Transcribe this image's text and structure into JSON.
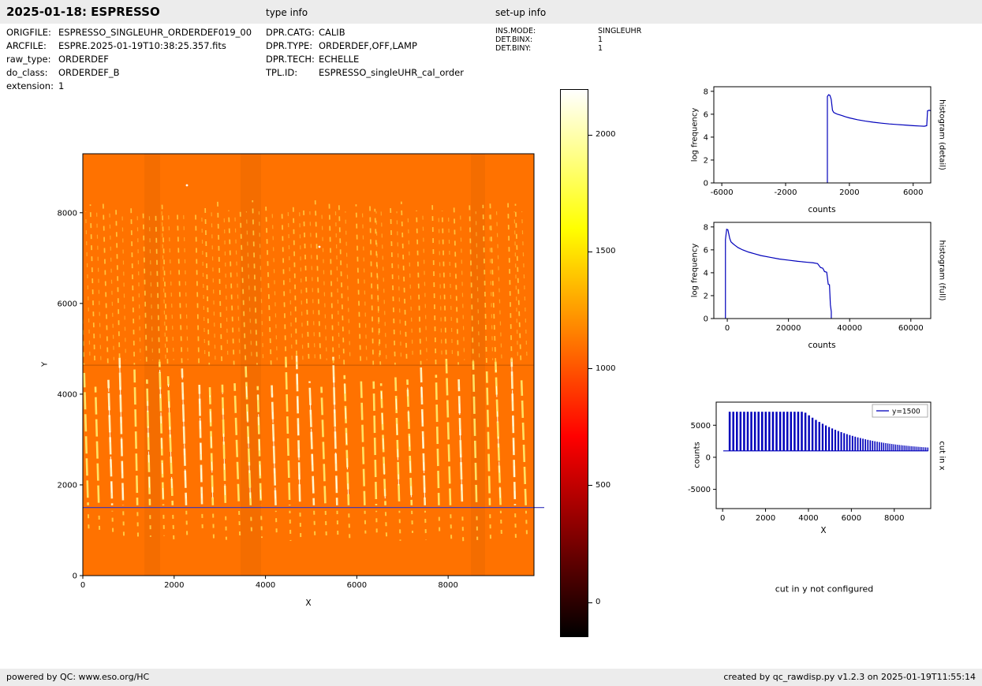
{
  "header": {
    "title": "2025-01-18: ESPRESSO",
    "type_info": "type info",
    "setup_info": "set-up info"
  },
  "metadata": {
    "left": [
      {
        "label": "ORIGFILE:",
        "value": "ESPRESSO_SINGLEUHR_ORDERDEF019_00"
      },
      {
        "label": "ARCFILE:",
        "value": "ESPRE.2025-01-19T10:38:25.357.fits"
      },
      {
        "label": "raw_type:",
        "value": "ORDERDEF"
      },
      {
        "label": "do_class:",
        "value": "ORDERDEF_B"
      },
      {
        "label": "extension:",
        "value": "1"
      }
    ],
    "type_info": [
      {
        "label": "DPR.CATG:",
        "value": "CALIB"
      },
      {
        "label": "DPR.TYPE:",
        "value": "ORDERDEF,OFF,LAMP"
      },
      {
        "label": "DPR.TECH:",
        "value": "ECHELLE"
      },
      {
        "label": "TPL.ID:",
        "value": "ESPRESSO_singleUHR_cal_order"
      }
    ],
    "setup_info": [
      {
        "label": "INS.MODE:",
        "value": "SINGLEUHR"
      },
      {
        "label": "DET.BINX:",
        "value": "1"
      },
      {
        "label": "DET.BINY:",
        "value": "1"
      }
    ]
  },
  "notes": {
    "cut_y": "cut in y not configured"
  },
  "footer": {
    "left": "powered by QC: www.eso.org/HC",
    "right": "created by qc_rawdisp.py v1.2.3 on 2025-01-19T11:55:14"
  },
  "colorbar": {
    "value_top": 2196,
    "value_bottom": -148,
    "ticks": [
      2000,
      1500,
      1000,
      500,
      0
    ],
    "gradient_stops": [
      "#000000 0%",
      "#460000 10%",
      "#8c0000 20%",
      "#d10000 30%",
      "#ff0000 36.5%",
      "#ff3900 45%",
      "#ff7d00 55%",
      "#ffbf00 65%",
      "#ffff00 74.6%",
      "#ffff69 85%",
      "#ffffcc 95%",
      "#ffffff 100%"
    ]
  },
  "chart_data": [
    {
      "id": "main",
      "type": "heatmap",
      "description": "ESPRESSO ORDERDEF raw frame: tilted echelle order traces (bright yellow streaks) on orange background",
      "xlabel": "X",
      "ylabel": "Y",
      "xlim": [
        0,
        9880
      ],
      "ylim": [
        0,
        9300
      ],
      "xticks": [
        0,
        2000,
        4000,
        6000,
        8000
      ],
      "yticks": [
        0,
        2000,
        4000,
        6000,
        8000
      ],
      "bg_color": "#ff7200",
      "streak_colors": [
        "#ffd84d",
        "#ffe96a",
        "#fff7c4"
      ],
      "cut_line": {
        "y": 1500,
        "color": "#3333bb"
      },
      "orders": {
        "count": 36,
        "upper_top": 8150,
        "upper_bottom": 4650,
        "bright_top": 4500,
        "bright_bottom": 1550,
        "low_top": 1430,
        "low_bottom": 700
      },
      "artifact_line_y": 4650,
      "dark_bands": [
        [
          78,
          20
        ],
        [
          200,
          26
        ],
        [
          492,
          18
        ]
      ],
      "specks": [
        [
          132,
          40
        ],
        [
          300,
          118
        ]
      ]
    },
    {
      "id": "hist-detail",
      "type": "line",
      "title_right": "histogram (detail)",
      "xlabel": "counts",
      "ylabel": "log frequency",
      "xlim": [
        -6500,
        7100
      ],
      "ylim": [
        0,
        8.4
      ],
      "xticks": [
        -6000,
        -2000,
        2000,
        6000
      ],
      "yticks": [
        0,
        2,
        4,
        6,
        8
      ],
      "color": "#0000bb",
      "x": [
        620,
        620,
        700,
        780,
        860,
        940,
        1020,
        1100,
        1250,
        1500,
        1750,
        2000,
        2500,
        3000,
        3500,
        4000,
        4500,
        5000,
        5500,
        6000,
        6400,
        6700,
        6850,
        6900,
        7000,
        7100
      ],
      "y": [
        0,
        7.55,
        7.7,
        7.65,
        7.3,
        6.35,
        6.15,
        6.1,
        6.0,
        5.9,
        5.78,
        5.68,
        5.52,
        5.4,
        5.3,
        5.22,
        5.15,
        5.1,
        5.05,
        5.0,
        4.97,
        4.95,
        5.0,
        6.3,
        6.35,
        6.3
      ]
    },
    {
      "id": "hist-full",
      "type": "line",
      "title_right": "histogram (full)",
      "xlabel": "counts",
      "ylabel": "log frequency",
      "xlim": [
        -4400,
        66500
      ],
      "ylim": [
        0,
        8.4
      ],
      "xticks": [
        0,
        20000,
        40000,
        60000
      ],
      "yticks": [
        0,
        2,
        4,
        6,
        8
      ],
      "color": "#0000bb",
      "x": [
        -600,
        -600,
        -200,
        200,
        800,
        1200,
        1800,
        2500,
        3500,
        5000,
        7000,
        9000,
        11000,
        14000,
        17000,
        20000,
        23000,
        26000,
        28000,
        29500,
        30500,
        31200,
        31800,
        32500,
        33000,
        33400,
        33700,
        34000,
        34000
      ],
      "y": [
        0,
        6.9,
        7.8,
        7.75,
        7.0,
        6.7,
        6.55,
        6.4,
        6.2,
        6.0,
        5.8,
        5.65,
        5.5,
        5.35,
        5.2,
        5.1,
        5.0,
        4.92,
        4.87,
        4.8,
        4.45,
        4.4,
        4.1,
        4.05,
        3.0,
        2.95,
        1.2,
        0.6,
        0
      ]
    },
    {
      "id": "cut-x",
      "type": "comb",
      "title_right": "cut in x",
      "xlabel": "X",
      "ylabel": "counts",
      "legend": "y=1500",
      "xlim": [
        -300,
        9700
      ],
      "ylim": [
        -8000,
        8600
      ],
      "xticks": [
        0,
        2000,
        4000,
        6000,
        8000
      ],
      "yticks": [
        -5000,
        0,
        5000
      ],
      "color": "#0000bb",
      "comb": {
        "x_start": 330,
        "x_end": 9580,
        "flat_end": 3800,
        "spacing_start": 168,
        "spacing_end": 58,
        "baseline": 1000,
        "amplitude": 6100,
        "decay_tau": 2350
      }
    }
  ]
}
